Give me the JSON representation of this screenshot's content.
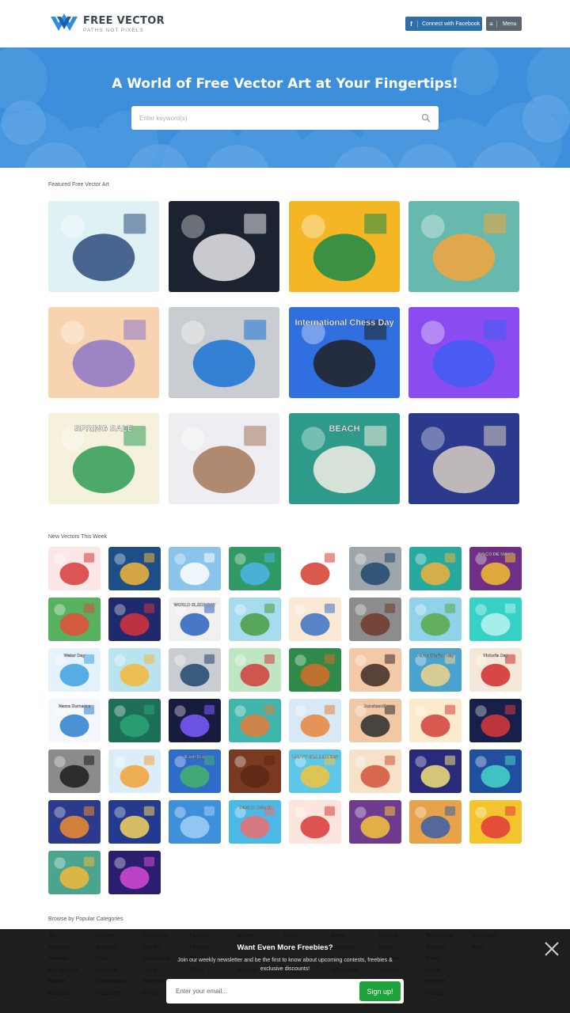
{
  "header": {
    "logo_name": "FREE VECTOR",
    "logo_tagline": "PATHS NOT PIXELS",
    "facebook_label": "Connect with Facebook",
    "menu_label": "Menu"
  },
  "hero": {
    "title": "A World of Free Vector Art at Your Fingertips!",
    "search_placeholder": "Enter keyword(s)"
  },
  "featured": {
    "title": "Featured Free Vector Art",
    "items": [
      {
        "name": "friends-playing-chess",
        "bg": "#dff1f5",
        "accent": "#2e4c7c"
      },
      {
        "name": "boxing-ring-arena",
        "bg": "#1c2330",
        "accent": "#e8e8ec"
      },
      {
        "name": "raised-fist-africa",
        "bg": "#f5b626",
        "accent": "#1b8a4a"
      },
      {
        "name": "woman-working-laptop",
        "bg": "#67b8ad",
        "accent": "#f4a53b"
      },
      {
        "name": "abstract-pastel-shapes",
        "bg": "#f7d3b0",
        "accent": "#8d76c9"
      },
      {
        "name": "blue-flyer-template",
        "bg": "#c9ccd0",
        "accent": "#1a72d6"
      },
      {
        "name": "international-chess-day",
        "bg": "#2f6fe0",
        "accent": "#222222",
        "text": "International Chess Day"
      },
      {
        "name": "purple-geometric-pattern",
        "bg": "#8a4cf0",
        "accent": "#3e5ef5"
      },
      {
        "name": "spring-sale-flowers",
        "bg": "#f6f1dc",
        "accent": "#2f9c55",
        "text": "SPRING SALE"
      },
      {
        "name": "teddy-bear-pattern",
        "bg": "#eeeef2",
        "accent": "#a5775b"
      },
      {
        "name": "beach-cleanup-stickers",
        "bg": "#2d9a8a",
        "accent": "#f5efe4",
        "text": "BEACH"
      },
      {
        "name": "moon-space-scene",
        "bg": "#2b3a8c",
        "accent": "#d9cfc2"
      }
    ]
  },
  "weekly": {
    "title": "New Vectors This Week",
    "items": [
      {
        "name": "blood-donation",
        "bg": "#fbe7e7",
        "accent": "#d63a3a"
      },
      {
        "name": "ramadan-family",
        "bg": "#1d4e87",
        "accent": "#f3b53a"
      },
      {
        "name": "water-drop-icons",
        "bg": "#8ac4ea",
        "accent": "#ffffff"
      },
      {
        "name": "earth-leaves",
        "bg": "#2f9a63",
        "accent": "#4db6e8"
      },
      {
        "name": "garuda-emblem",
        "bg": "#ffffff",
        "accent": "#d53b2e"
      },
      {
        "name": "business-cards-blue",
        "bg": "#9ea5ab",
        "accent": "#20466e"
      },
      {
        "name": "spring-forest-bowl",
        "bg": "#27a9a0",
        "accent": "#f1b03b"
      },
      {
        "name": "cinco-de-mayo",
        "bg": "#6f2f86",
        "accent": "#f2bd2f",
        "text": "CINCO DE MAYO"
      },
      {
        "name": "green-stickers",
        "bg": "#56b25e",
        "accent": "#e64b3a"
      },
      {
        "name": "fireworks-usa-flag",
        "bg": "#1e2a6b",
        "accent": "#d7333a"
      },
      {
        "name": "world-sleep-day",
        "bg": "#f0f0f0",
        "accent": "#2b62c0",
        "text": "WORLD SLEEP DAY"
      },
      {
        "name": "family-park",
        "bg": "#a6dcee",
        "accent": "#4a9c3f"
      },
      {
        "name": "happy-family",
        "bg": "#fbe9d6",
        "accent": "#3b72c4"
      },
      {
        "name": "business-cards-brown",
        "bg": "#8c8c8c",
        "accent": "#6e3a2a"
      },
      {
        "name": "farmer-field",
        "bg": "#8fd2e9",
        "accent": "#5aa947"
      },
      {
        "name": "teal-abstract",
        "bg": "#36d2c8",
        "accent": "#b8f3ef"
      },
      {
        "name": "water-day",
        "bg": "#e3f2fb",
        "accent": "#3fa0e0",
        "text": "Water Day"
      },
      {
        "name": "travel-suitcase",
        "bg": "#b9e3ef",
        "accent": "#f4b93a"
      },
      {
        "name": "business-cards-grey",
        "bg": "#c9cdd1",
        "accent": "#20466e"
      },
      {
        "name": "blood-bag-hands",
        "bg": "#bfe6c2",
        "accent": "#d43b3b"
      },
      {
        "name": "orangutan-jungle",
        "bg": "#2f8a49",
        "accent": "#d76b2a"
      },
      {
        "name": "woman-portrait",
        "bg": "#f3c9a8",
        "accent": "#3d2a22"
      },
      {
        "name": "humanitarian-day",
        "bg": "#4aa3cf",
        "accent": "#f0d48a",
        "text": "Humanitarian Day"
      },
      {
        "name": "victoria-day",
        "bg": "#f6e8d8",
        "accent": "#cf2b2b",
        "text": "Victoria Day"
      },
      {
        "name": "certificate",
        "bg": "#f4f7fb",
        "accent": "#2b7fcf",
        "text": "Name Surname"
      },
      {
        "name": "green-jungle-frame",
        "bg": "#1e6f58",
        "accent": "#2aa676"
      },
      {
        "name": "ai-chip-glow",
        "bg": "#171b3d",
        "accent": "#7a5cff"
      },
      {
        "name": "mandala",
        "bg": "#3fb6ab",
        "accent": "#e67b3a"
      },
      {
        "name": "icon-set",
        "bg": "#d7e9f5",
        "accent": "#e8843b"
      },
      {
        "name": "juneteenth",
        "bg": "#f2c7a4",
        "accent": "#2b2b2b",
        "text": "Juneteenth"
      },
      {
        "name": "family-portrait",
        "bg": "#fbeacc",
        "accent": "#d1403a"
      },
      {
        "name": "city-night-skyline",
        "bg": "#16204a",
        "accent": "#d93a3a"
      },
      {
        "name": "business-cards-dark",
        "bg": "#8b8b8b",
        "accent": "#1c1c1c"
      },
      {
        "name": "business-growth",
        "bg": "#dbeef8",
        "accent": "#f0a23a"
      },
      {
        "name": "earth-day-girl",
        "bg": "#2f6bc9",
        "accent": "#46b36b",
        "text": "Earth Day"
      },
      {
        "name": "wood-texture",
        "bg": "#7a3a22",
        "accent": "#5c2815"
      },
      {
        "name": "happy-graduation",
        "bg": "#5cc7e8",
        "accent": "#f2c43a",
        "text": "HAPPY GRADUATION"
      },
      {
        "name": "music-instruments",
        "bg": "#f6e1c9",
        "accent": "#d2523b"
      },
      {
        "name": "meteor-shower",
        "bg": "#2a2a7a",
        "accent": "#f5e27a"
      },
      {
        "name": "robot-tech",
        "bg": "#1f4f9e",
        "accent": "#47d6c8"
      },
      {
        "name": "planets-space",
        "bg": "#2b3a8c",
        "accent": "#f08b2e"
      },
      {
        "name": "night-city",
        "bg": "#243a8f",
        "accent": "#f4d35e"
      },
      {
        "name": "blue-cloud-frame",
        "bg": "#3f8fdb",
        "accent": "#9fd0f5"
      },
      {
        "name": "back-to-school",
        "bg": "#4ab9e6",
        "accent": "#f06d6d",
        "text": "Back to School"
      },
      {
        "name": "flag-woman",
        "bg": "#fbe5dc",
        "accent": "#d83a3a"
      },
      {
        "name": "gold-coins-cave",
        "bg": "#6e3b8f",
        "accent": "#f5c63a"
      },
      {
        "name": "egypt-pharaoh",
        "bg": "#e8a24a",
        "accent": "#3a5fa8"
      },
      {
        "name": "comic-explosion",
        "bg": "#f3c42e",
        "accent": "#e03a3a"
      },
      {
        "name": "crypto-man",
        "bg": "#4ba58e",
        "accent": "#f3b93a"
      },
      {
        "name": "neon-city",
        "bg": "#2b1e6e",
        "accent": "#d64ad8"
      }
    ]
  },
  "categories": {
    "title": "Browse by Popular Categories",
    "columns": [
      [
        "3D",
        "Abstract",
        "Animals",
        "Background",
        "Banner",
        "Beaches"
      ],
      [
        "Borders",
        "Business",
        "Cars",
        "Cartoons",
        "Celebrations",
        "Characters"
      ],
      [
        "Christmas",
        "Clip Art",
        "Computers",
        "Design",
        "Elements",
        "Emojis"
      ],
      [
        "Fantasy",
        "Fashion",
        "Flags",
        "Floral",
        "Food",
        "Fun"
      ],
      [
        "Games",
        "Graphics",
        "Halloween",
        "Holidays",
        "Icons",
        "Illustrations"
      ],
      [
        "Logos",
        "Maps",
        "Music",
        "Nature",
        "Objects",
        "Patterns"
      ],
      [
        "Retro",
        "Seasonal",
        "Shapes",
        "Silhouettes",
        "Space",
        "Sports"
      ],
      [
        "Stickers",
        "Signs",
        "Summer",
        "Symbols",
        "Tattoos",
        "Text"
      ],
      [
        "Technology",
        "Textures",
        "Trees",
        "Urban",
        "Vehicles",
        "Vintage"
      ],
      [
        "Wallpaper",
        "Web"
      ]
    ]
  },
  "newsletter": {
    "title": "Want Even More Freebies?",
    "subtitle": "Join our weekly newsletter and be the first to know about upcoming contests, freebies & exclusive discounts!",
    "email_placeholder": "Enter your email...",
    "signup_label": "Sign up!"
  },
  "colors": {
    "brand_blue": "#3d8fdb",
    "facebook_blue": "#2e6fa8",
    "signup_green": "#1ea33b"
  }
}
